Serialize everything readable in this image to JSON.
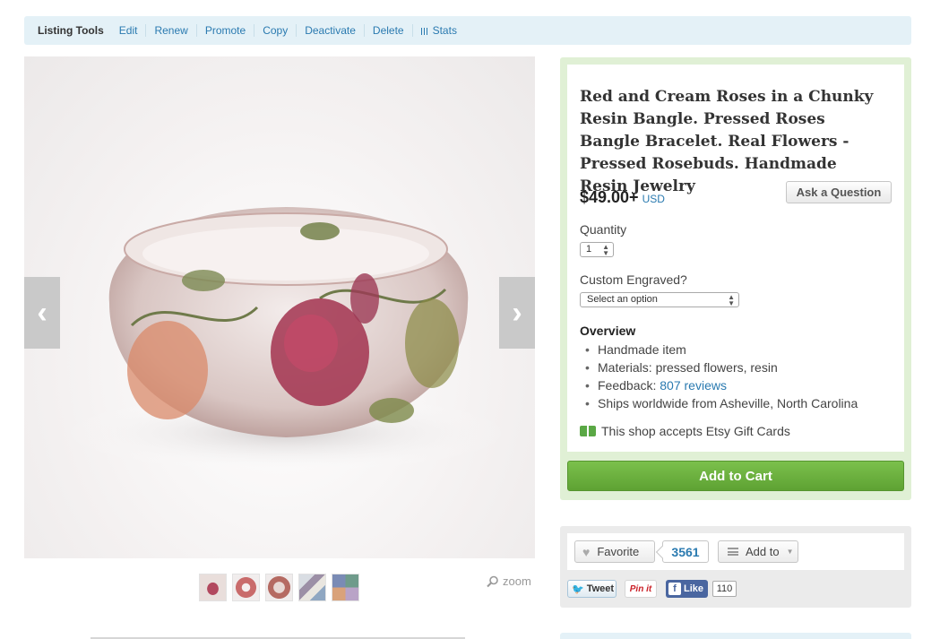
{
  "tools": {
    "label": "Listing Tools",
    "links": [
      "Edit",
      "Renew",
      "Promote",
      "Copy",
      "Deactivate",
      "Delete",
      "Stats"
    ]
  },
  "gallery": {
    "prev_icon": "chevron-left-icon",
    "next_icon": "chevron-right-icon",
    "thumb_count": 5,
    "zoom_label": "zoom"
  },
  "listing": {
    "title": "Red and Cream Roses in a Chunky Resin Bangle. Pressed Roses Bangle Bracelet. Real Flowers - Pressed Rosebuds. Handmade Resin Jewelry",
    "price": "$49.00+",
    "currency": "USD",
    "ask_button": "Ask a Question",
    "quantity_label": "Quantity",
    "quantity_value": "1",
    "engraved_label": "Custom Engraved?",
    "engraved_value": "Select an option",
    "overview_heading": "Overview",
    "overview": {
      "item1": "Handmade item",
      "item2": "Materials: pressed flowers, resin",
      "feedback_label": "Feedback:",
      "feedback_link": "807 reviews",
      "item4": "Ships worldwide from Asheville, North Carolina"
    },
    "gift_text": "This shop accepts Etsy Gift Cards",
    "cart_button": "Add to Cart"
  },
  "social": {
    "favorite_label": "Favorite",
    "favorite_count": "3561",
    "add_to_label": "Add to",
    "tweet_label": "Tweet",
    "pin_label": "Pin it",
    "like_label": "Like",
    "like_count": "110"
  },
  "colors": {
    "link": "#2a7ab0",
    "buybox_bg": "#e0f0d5",
    "cart_green": "#6ab13d",
    "tools_bg": "#e4f1f7"
  }
}
